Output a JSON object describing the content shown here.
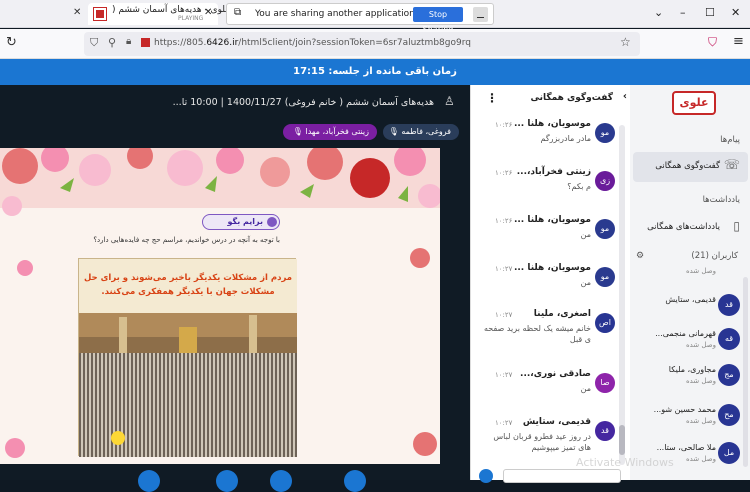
{
  "browser": {
    "tab1_title": "علوی - هدیه‌های آسمان ششم (",
    "tab1_sub": "PLAYING",
    "share_message": "You are sharing another application window.",
    "share_button": "Stop Sharing",
    "url_prefix": "https://805.",
    "url_host": "6426.ir",
    "url_path": "/html5client/join?sessionToken=6sr7aluztmb8go9rq"
  },
  "session": {
    "timer_label": "زمان باقی مانده از جلسه: 17:15"
  },
  "presentation": {
    "meeting_title": "هدیه‌های آسمان ششم ( خانم فروغی) 1400/11/27 | 10:00 تا...",
    "talkers": [
      "زینتی فخرآباد، مهدا",
      "فروغی، فاطمه"
    ],
    "slide": {
      "heading": "برایم بگو",
      "question": "با توجه به آنچه در درس خواندیم، مراسم حج چه فایده‌هایی دارد؟",
      "caption_top": "مردم از مشکلات یکدیگر باخبر می‌شوند و برای حل",
      "caption_bottom": "مشکلات جهان با یکدیگر همفکری می‌کنند."
    }
  },
  "chat": {
    "title": "گفت‌وگوی همگانی",
    "messages": [
      {
        "name": "موسویان، هلنا ...",
        "time": "۱۰:۲۶",
        "text": "مادر مادربزرگم",
        "avatar": "مو",
        "color": "#2a3a8f"
      },
      {
        "name": "زینتی فخرآباد،...",
        "time": "۱۰:۲۶",
        "text": "م بکم؟",
        "avatar": "زی",
        "color": "#6a1b9a"
      },
      {
        "name": "موسویان، هلنا ...",
        "time": "۱۰:۲۶",
        "text": "من",
        "avatar": "مو",
        "color": "#2a3a8f"
      },
      {
        "name": "موسویان، هلنا ...",
        "time": "۱۰:۲۷",
        "text": "من",
        "avatar": "مو",
        "color": "#2a3a8f"
      },
      {
        "name": "اصغری، ملینا",
        "time": "۱۰:۲۷",
        "text": "خانم میشه یک لحظه برید صفحه ی قبل",
        "avatar": "اص",
        "color": "#283593"
      },
      {
        "name": "صادقی نوری،...",
        "time": "۱۰:۲۷",
        "text": "من",
        "avatar": "صا",
        "color": "#8e24aa"
      },
      {
        "name": "قدیمی، ستایش",
        "time": "۱۰:۲۷",
        "text": "در روز عید فطرو قربان لباس های تمیز میپوشیم",
        "avatar": "قد",
        "color": "#4527a0"
      }
    ]
  },
  "sidebar": {
    "logo": "علوی",
    "messages_heading": "پیام‌ها",
    "public_chat": "گفت‌وگوی همگانی",
    "notes_heading": "یادداشت‌ها",
    "shared_notes": "یادداشت‌های همگانی",
    "users_heading": "کاربران (21)",
    "users": [
      {
        "name": "",
        "status": "وصل شده",
        "avatar": ""
      },
      {
        "name": "قدیمی، ستایش",
        "status": "",
        "avatar": "قد"
      },
      {
        "name": "قهرمانی منجمی...",
        "status": "وصل شده",
        "avatar": "قه"
      },
      {
        "name": "مجاوری، ملیکا",
        "status": "وصل شده",
        "avatar": "مج"
      },
      {
        "name": "محمد حسین شو...",
        "status": "وصل شده",
        "avatar": "مح"
      },
      {
        "name": "ملا صالحی، ستا...",
        "status": "وصل شده",
        "avatar": "مل"
      }
    ]
  },
  "watermark": "Activate Windows",
  "colors": {
    "accent": "#1b76d2",
    "stage_bg": "#101b25",
    "talker1": "#7b1fa2",
    "talker2": "#2a3d5a"
  }
}
